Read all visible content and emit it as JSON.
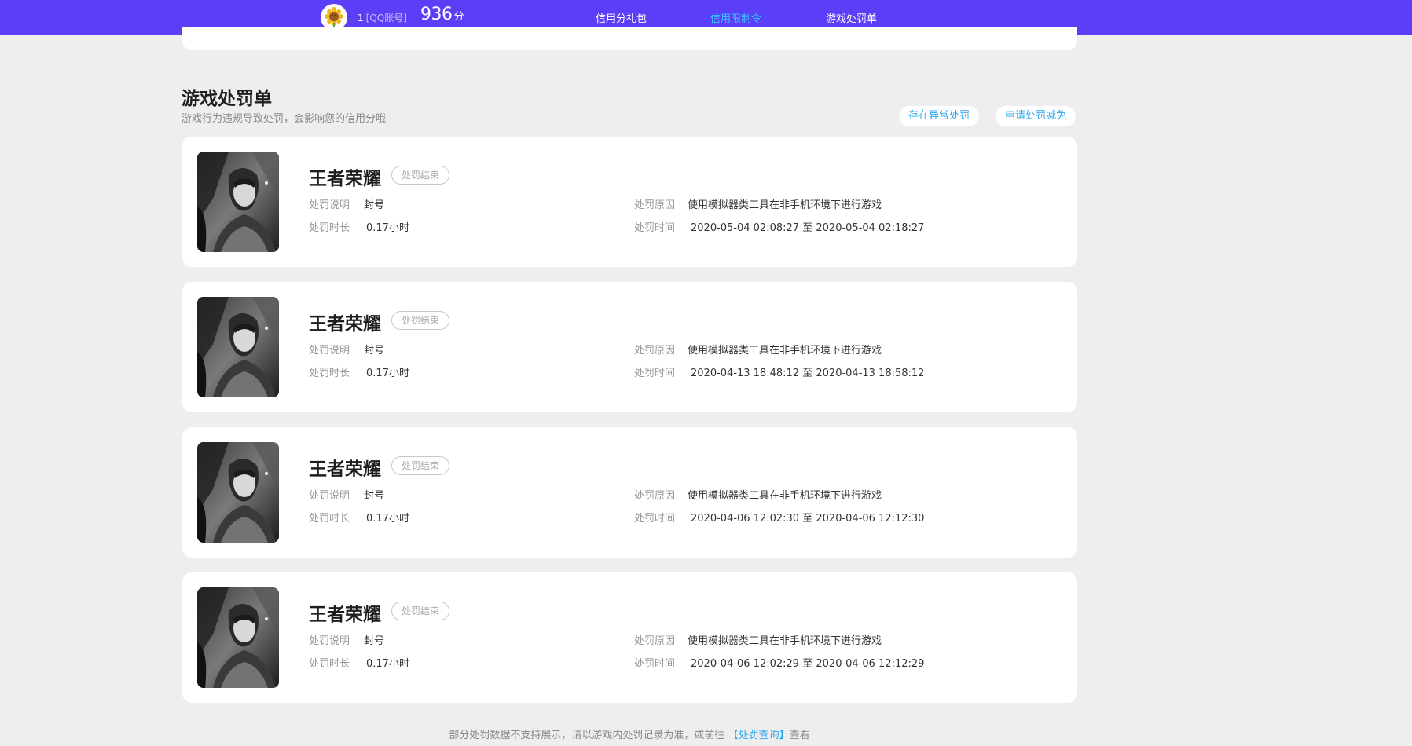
{
  "header": {
    "account_id": "1",
    "account_tag": "[QQ账号]",
    "score": "936",
    "score_unit": "分",
    "nav": [
      {
        "label": "信用分礼包",
        "active": false
      },
      {
        "label": "信用限制令",
        "active": true
      },
      {
        "label": "游戏处罚单",
        "active": false
      }
    ],
    "accent_color": "#5b3ff6",
    "active_color": "#35c8ff"
  },
  "section": {
    "title": "游戏处罚单",
    "subtitle": "游戏行为违规导致处罚，会影响您的信用分哦",
    "buttons": {
      "appeal_abnormal": "存在异常处罚",
      "apply_reduction": "申请处罚减免"
    }
  },
  "labels": {
    "desc": "处罚说明",
    "duration": "处罚时长",
    "reason": "处罚原因",
    "time": "处罚时间",
    "to": "至"
  },
  "punishments": [
    {
      "game": "王者荣耀",
      "status": "处罚结束",
      "desc": "封号",
      "duration": "0.17小时",
      "reason": "使用模拟器类工具在非手机环境下进行游戏",
      "start": "2020-05-04 02:08:27",
      "end": "2020-05-04 02:18:27"
    },
    {
      "game": "王者荣耀",
      "status": "处罚结束",
      "desc": "封号",
      "duration": "0.17小时",
      "reason": "使用模拟器类工具在非手机环境下进行游戏",
      "start": "2020-04-13 18:48:12",
      "end": "2020-04-13 18:58:12"
    },
    {
      "game": "王者荣耀",
      "status": "处罚结束",
      "desc": "封号",
      "duration": "0.17小时",
      "reason": "使用模拟器类工具在非手机环境下进行游戏",
      "start": "2020-04-06 12:02:30",
      "end": "2020-04-06 12:12:30"
    },
    {
      "game": "王者荣耀",
      "status": "处罚结束",
      "desc": "封号",
      "duration": "0.17小时",
      "reason": "使用模拟器类工具在非手机环境下进行游戏",
      "start": "2020-04-06 12:02:29",
      "end": "2020-04-06 12:12:29"
    }
  ],
  "footer": {
    "note_before": "部分处罚数据不支持展示，请以游戏内处罚记录为准，或前往",
    "link": "【处罚查询】",
    "note_after": "查看"
  }
}
